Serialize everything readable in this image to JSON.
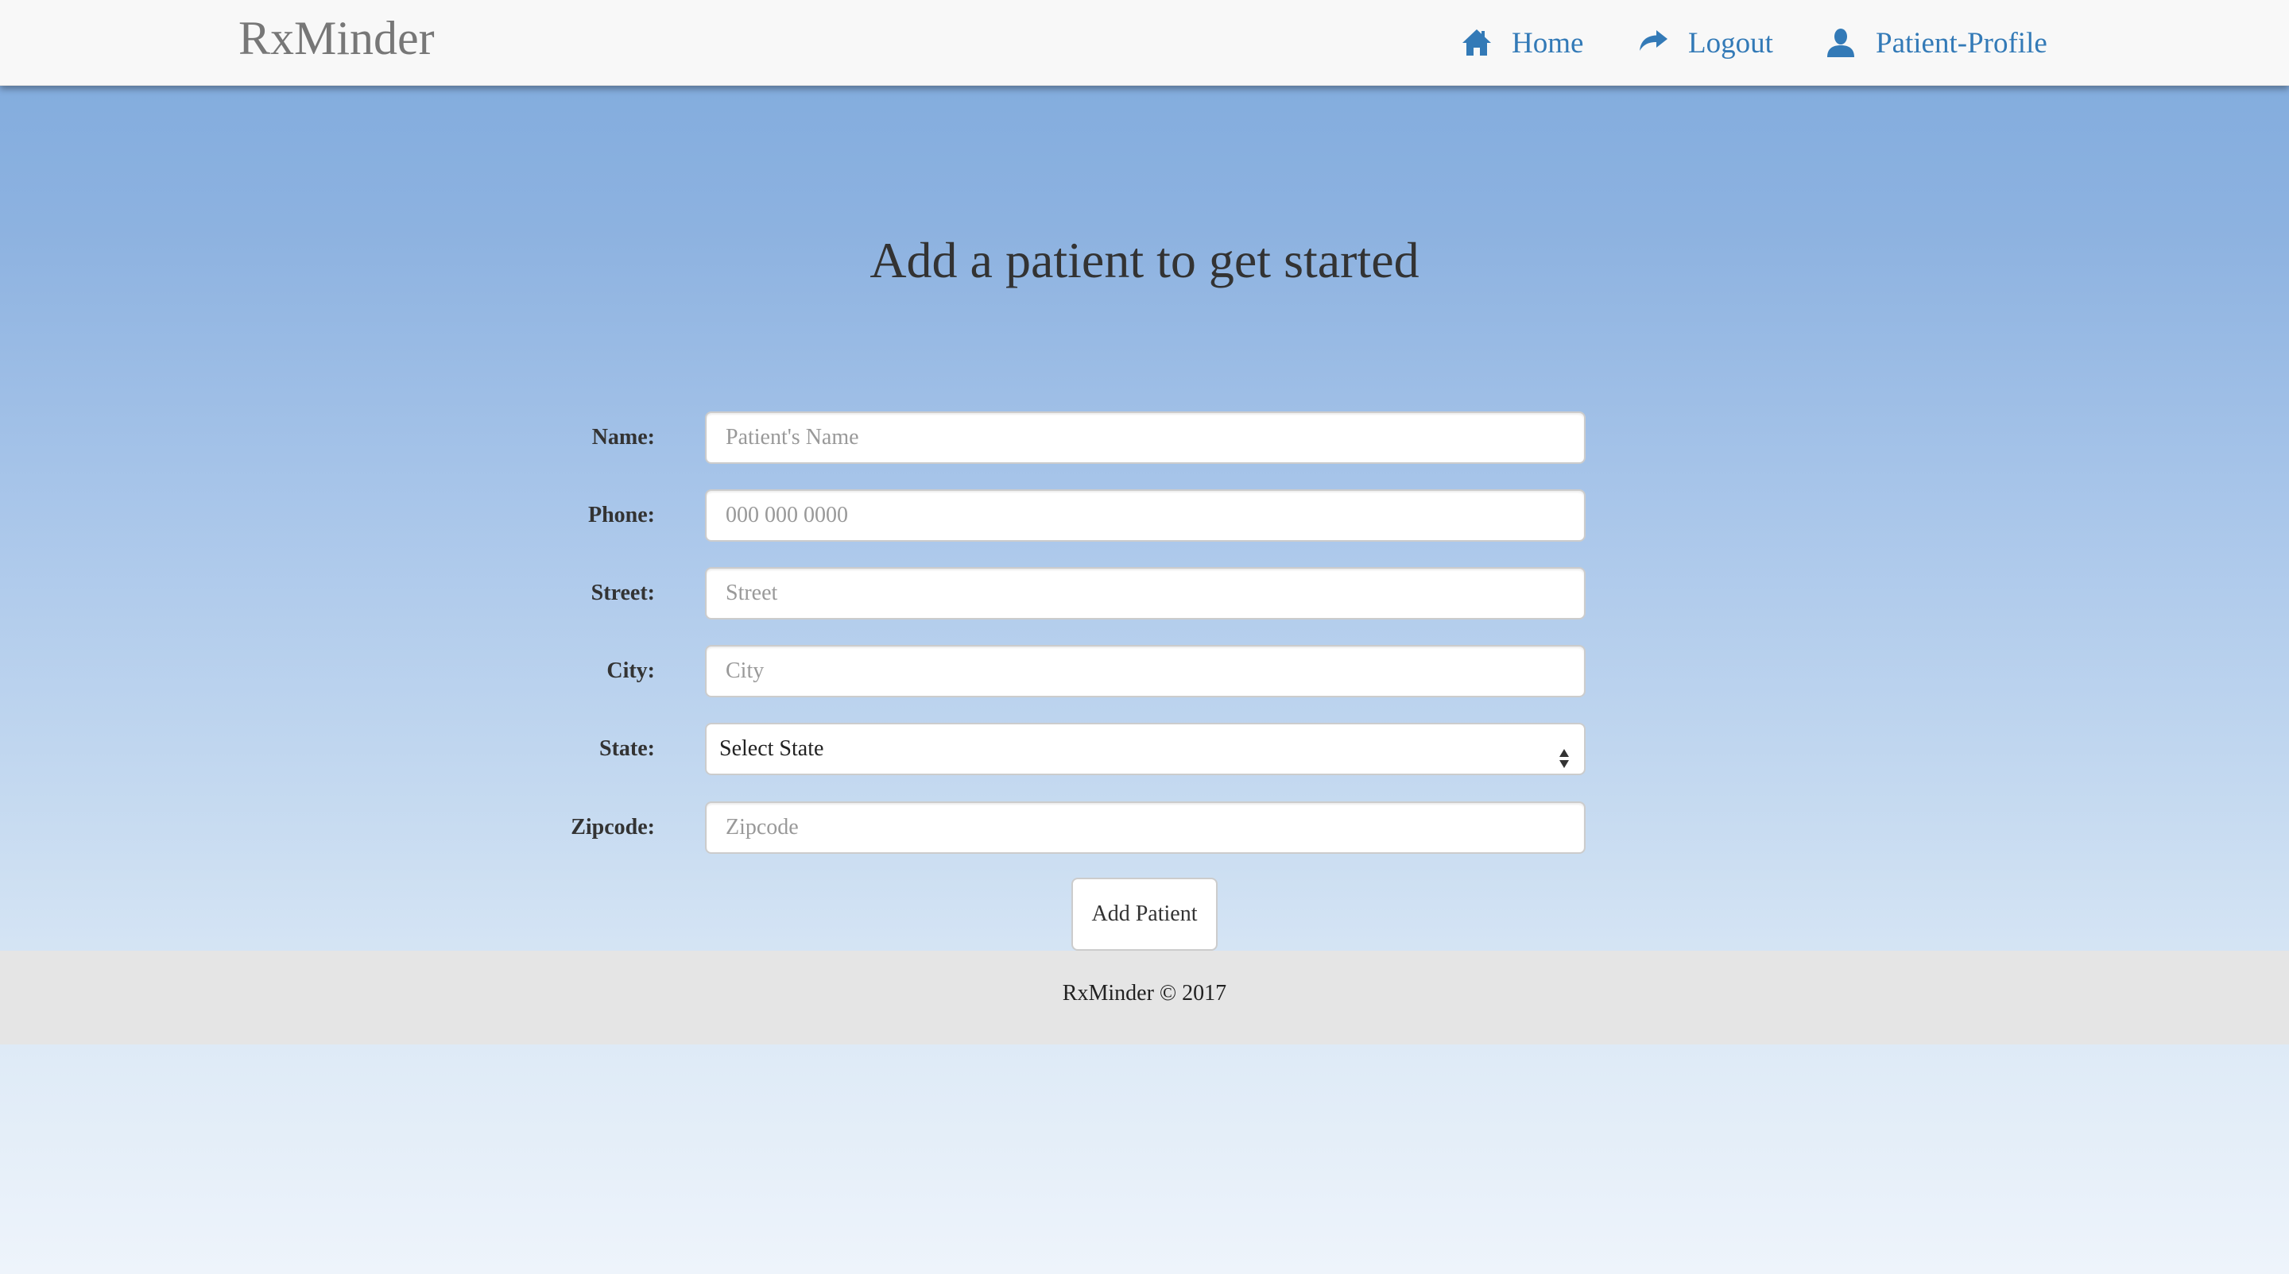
{
  "navbar": {
    "brand": "RxMinder",
    "items": [
      {
        "label": "Home",
        "icon": "home-icon"
      },
      {
        "label": "Logout",
        "icon": "share-arrow-icon"
      },
      {
        "label": "Patient-Profile",
        "icon": "user-icon"
      }
    ]
  },
  "main": {
    "title": "Add a patient to get started"
  },
  "form": {
    "name": {
      "label": "Name:",
      "placeholder": "Patient's Name"
    },
    "phone": {
      "label": "Phone:",
      "placeholder": "000 000 0000"
    },
    "street": {
      "label": "Street:",
      "placeholder": "Street"
    },
    "city": {
      "label": "City:",
      "placeholder": "City"
    },
    "state": {
      "label": "State:",
      "selected": "Select State"
    },
    "zipcode": {
      "label": "Zipcode:",
      "placeholder": "Zipcode"
    },
    "submit_label": "Add Patient"
  },
  "footer": {
    "text": "RxMinder © 2017"
  },
  "colors": {
    "link": "#337ab7",
    "navbar_bg": "#f8f8f8",
    "footer_bg": "#e5e5e5"
  }
}
